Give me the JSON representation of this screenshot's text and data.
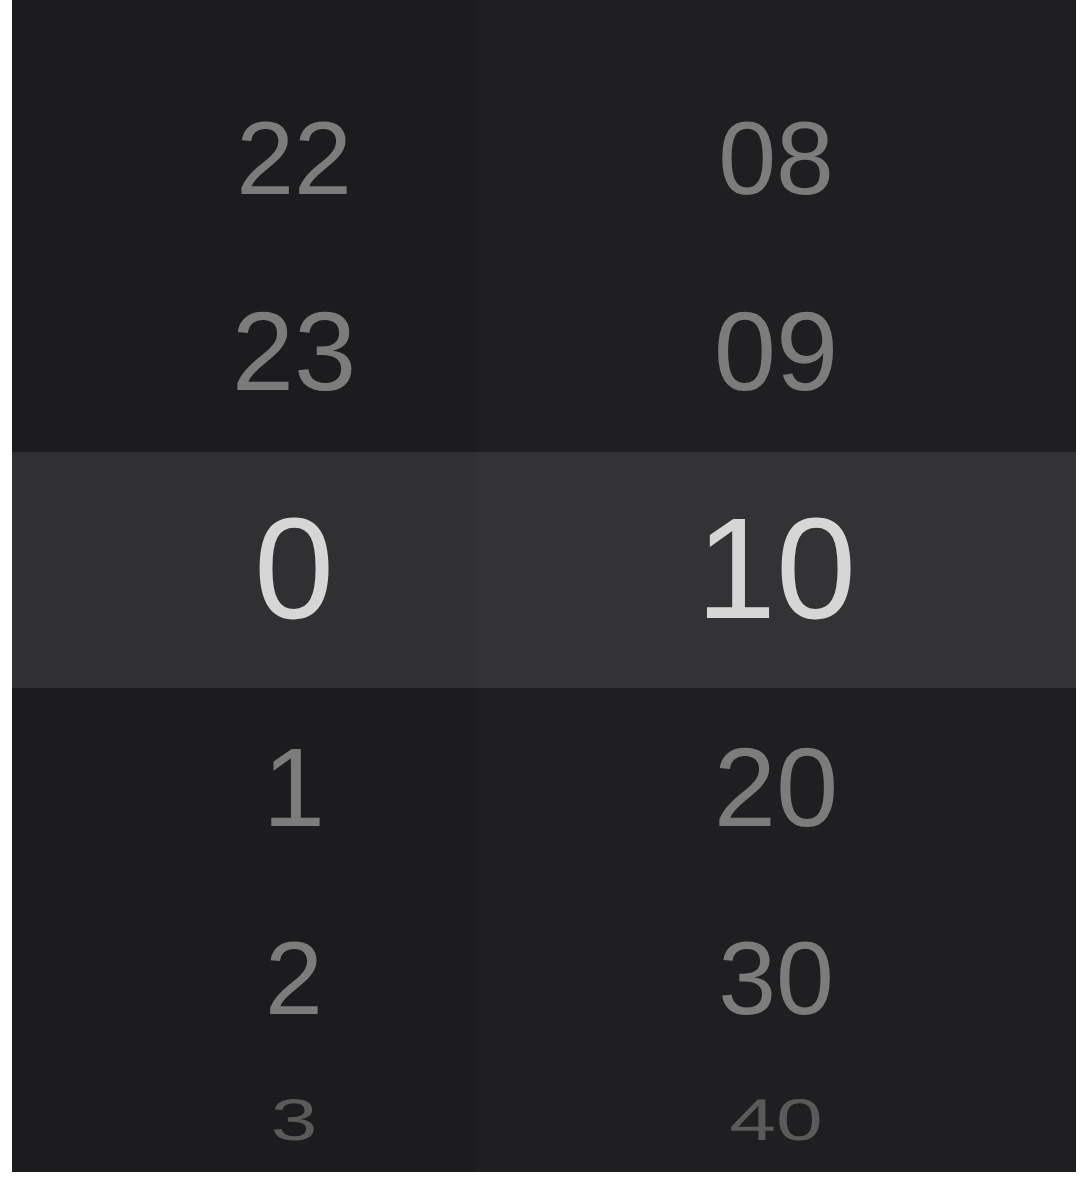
{
  "columns": [
    {
      "items": [
        {
          "label": "22",
          "selected": false
        },
        {
          "label": "23",
          "selected": false
        },
        {
          "label": "0",
          "selected": true
        },
        {
          "label": "1",
          "selected": false
        },
        {
          "label": "2",
          "selected": false
        },
        {
          "label": "3",
          "selected": false
        }
      ]
    },
    {
      "items": [
        {
          "label": "08",
          "selected": false
        },
        {
          "label": "09",
          "selected": false
        },
        {
          "label": "10",
          "selected": true
        },
        {
          "label": "20",
          "selected": false
        },
        {
          "label": "30",
          "selected": false
        },
        {
          "label": "40",
          "selected": false
        }
      ]
    }
  ]
}
